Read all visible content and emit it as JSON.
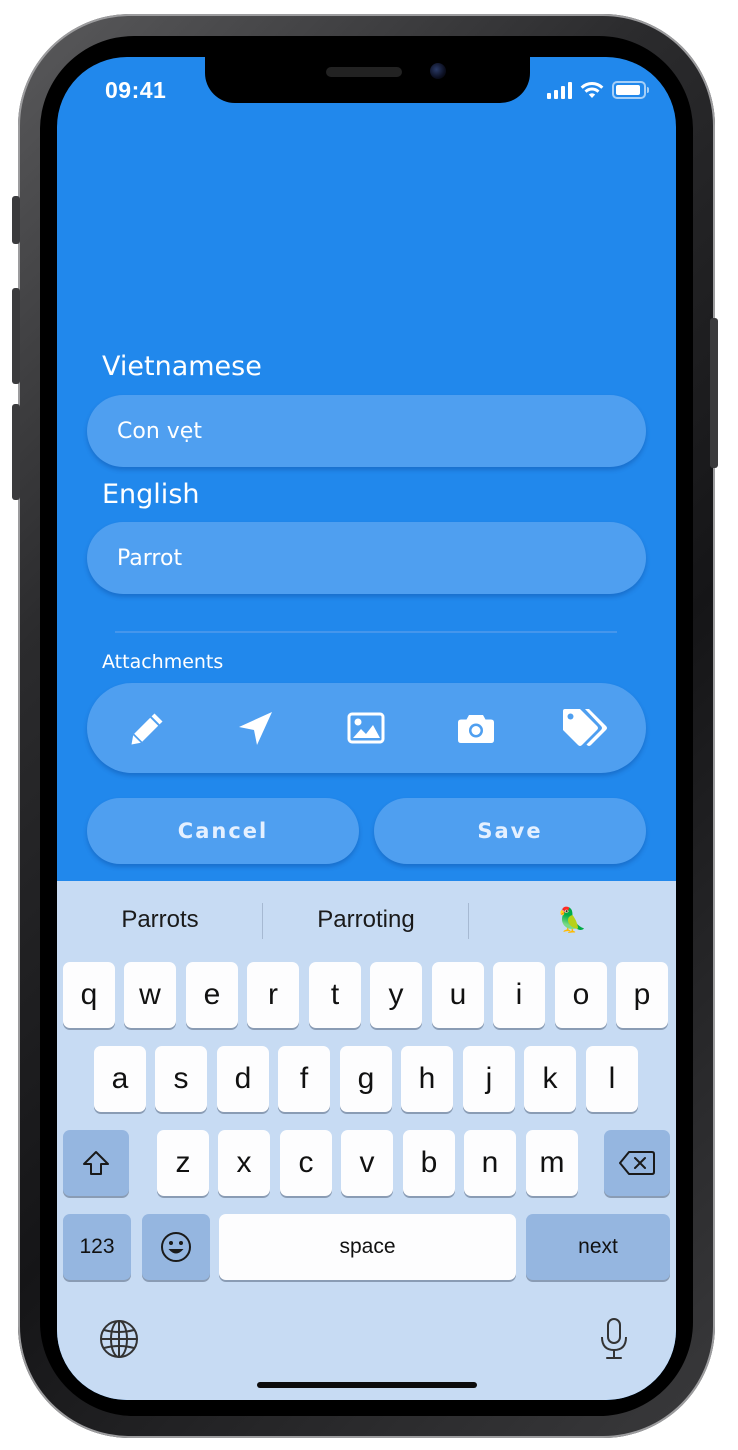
{
  "status_bar": {
    "time": "09:41",
    "icons": [
      "cellular-signal-icon",
      "wifi-icon",
      "battery-icon"
    ]
  },
  "form": {
    "vietnamese_label": "Vietnamese",
    "vietnamese_value": "Con vẹt",
    "english_label": "English",
    "english_value": "Parrot",
    "attachments_label": "Attachments",
    "attachments": [
      "pencil-icon",
      "location-arrow-icon",
      "image-icon",
      "camera-icon",
      "tags-icon"
    ],
    "cancel_label": "Cancel",
    "save_label": "Save"
  },
  "keyboard": {
    "suggestions": [
      "Parrots",
      "Parroting",
      "🦜"
    ],
    "row1": [
      "q",
      "w",
      "e",
      "r",
      "t",
      "y",
      "u",
      "i",
      "o",
      "p"
    ],
    "row2": [
      "a",
      "s",
      "d",
      "f",
      "g",
      "h",
      "j",
      "k",
      "l"
    ],
    "row3": [
      "z",
      "x",
      "c",
      "v",
      "b",
      "n",
      "m"
    ],
    "numbers_label": "123",
    "space_label": "space",
    "next_label": "next"
  },
  "colors": {
    "background": "#2188ec",
    "field": "#4f9ff0",
    "keyboard": "#c7dbf3",
    "key": "#fdfdfe",
    "function_key": "#95b6e0"
  }
}
